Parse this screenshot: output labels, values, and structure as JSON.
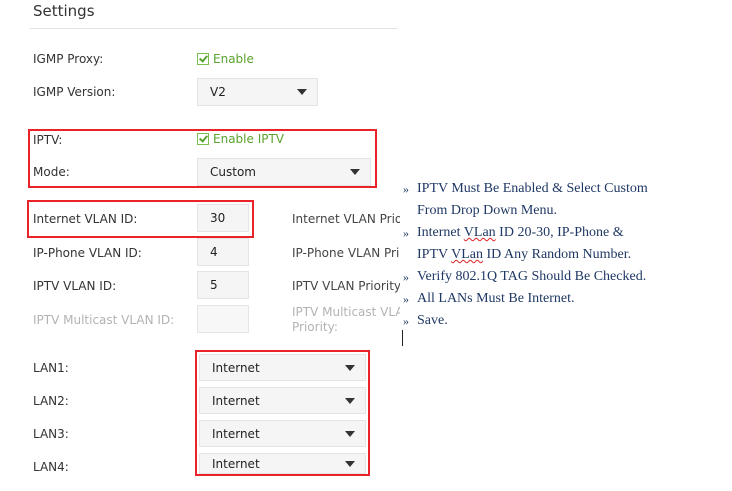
{
  "section_title": "Settings",
  "igmp_proxy": {
    "label": "IGMP Proxy:",
    "checkbox_label": "Enable",
    "checked": true
  },
  "igmp_version": {
    "label": "IGMP Version:",
    "value": "V2"
  },
  "iptv": {
    "label": "IPTV:",
    "checkbox_label": "Enable IPTV",
    "checked": true
  },
  "mode": {
    "label": "Mode:",
    "value": "Custom"
  },
  "internet_vlan": {
    "label": "Internet VLAN ID:",
    "value": "30",
    "priority_label": "Internet VLAN Prio"
  },
  "phone_vlan": {
    "label": "IP-Phone VLAN ID:",
    "value": "4",
    "priority_label": "IP-Phone VLAN Pri"
  },
  "iptv_vlan": {
    "label": "IPTV VLAN ID:",
    "value": "5",
    "priority_label": "IPTV VLAN Priority"
  },
  "multicast_vlan": {
    "label": "IPTV Multicast VLAN ID:",
    "value": "",
    "priority_label_line1": "IPTV Multicast VLA",
    "priority_label_line2": "Priority:"
  },
  "lan1": {
    "label": "LAN1:",
    "value": "Internet"
  },
  "lan2": {
    "label": "LAN2:",
    "value": "Internet"
  },
  "lan3": {
    "label": "LAN3:",
    "value": "Internet"
  },
  "lan4": {
    "label": "LAN4:",
    "value": "Internet"
  },
  "notes": {
    "bullet": "»",
    "n1_line1": "IPTV Must Be Enabled & Select Custom",
    "n1_line2": "From Drop Down Menu.",
    "n2_a": "Internet ",
    "n2_b": "VLan",
    "n2_c": " ID 20-30, IP-Phone &",
    "n2_d": "IPTV ",
    "n2_e": "VLan",
    "n2_f": " ID Any Random Number.",
    "n3": "Verify 802.1Q TAG Should Be Checked.",
    "n4": "All LANs Must Be Internet.",
    "n5": "Save."
  },
  "colors": {
    "highlight_red": "#e8232a",
    "accent_green": "#5aa22e",
    "note_blue": "#1f3864"
  }
}
